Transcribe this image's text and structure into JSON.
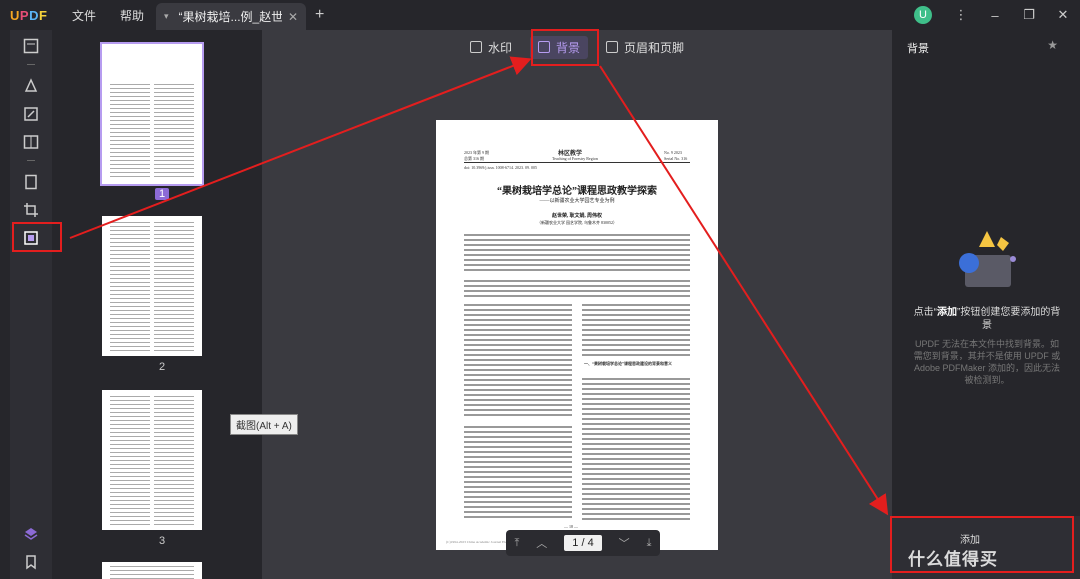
{
  "app": {
    "logo": "UPDF",
    "menu": [
      "文件",
      "帮助"
    ]
  },
  "tab": {
    "title": "“果树栽培...例_赵世荣"
  },
  "user": {
    "initial": "U"
  },
  "toolbar": {
    "watermark": "水印",
    "background": "背景",
    "header_footer": "页眉和页脚"
  },
  "thumbnails": {
    "pages": [
      "1",
      "2",
      "3"
    ]
  },
  "document": {
    "header_left": "2023 年第 9 期",
    "header_left2": "总第 316 期",
    "journal": "林区教学",
    "journal_en": "Teaching of Forestry Region",
    "header_right": "No. 9  2023",
    "header_right2": "Serial No. 316",
    "doi": "doi: 10.3969/j.issn. 1008-6714. 2023. 09. 005",
    "title": "“果树栽培学总论”课程思政教学探索",
    "subtitle": "——以新疆农业大学园艺专业为例",
    "authors": "赵世荣, 耿文娟, 周伟权",
    "affiliation": "（新疆农业大学 园艺学院, 乌鲁木齐 830052）",
    "section": "一、“果树栽培学总论”课程思政建设的背景和意义",
    "footer": "(C)1994-2023 China Academic Journal Electronic Publishing House. All rights reserved.   http://www.cnki.net",
    "page_marker": "— 18 —"
  },
  "navigation": {
    "current": "1",
    "sep": "/",
    "total": "4"
  },
  "tooltip": {
    "screenshot": "截图(Alt + A)"
  },
  "right_panel": {
    "title": "背景",
    "hint_pre": "点击“",
    "hint_bold": "添加",
    "hint_post": "”按钮创建您要添加的背景",
    "note": "UPDF 无法在本文件中找到背景。如需您到背景，其并不是使用 UPDF 或 Adobe PDFMaker 添加的，因此无法被检测到。",
    "add_label": "添加"
  },
  "watermark_brand": "什么值得买",
  "colors": {
    "annotation": "#e31e1e",
    "accent": "#b69cf0"
  }
}
